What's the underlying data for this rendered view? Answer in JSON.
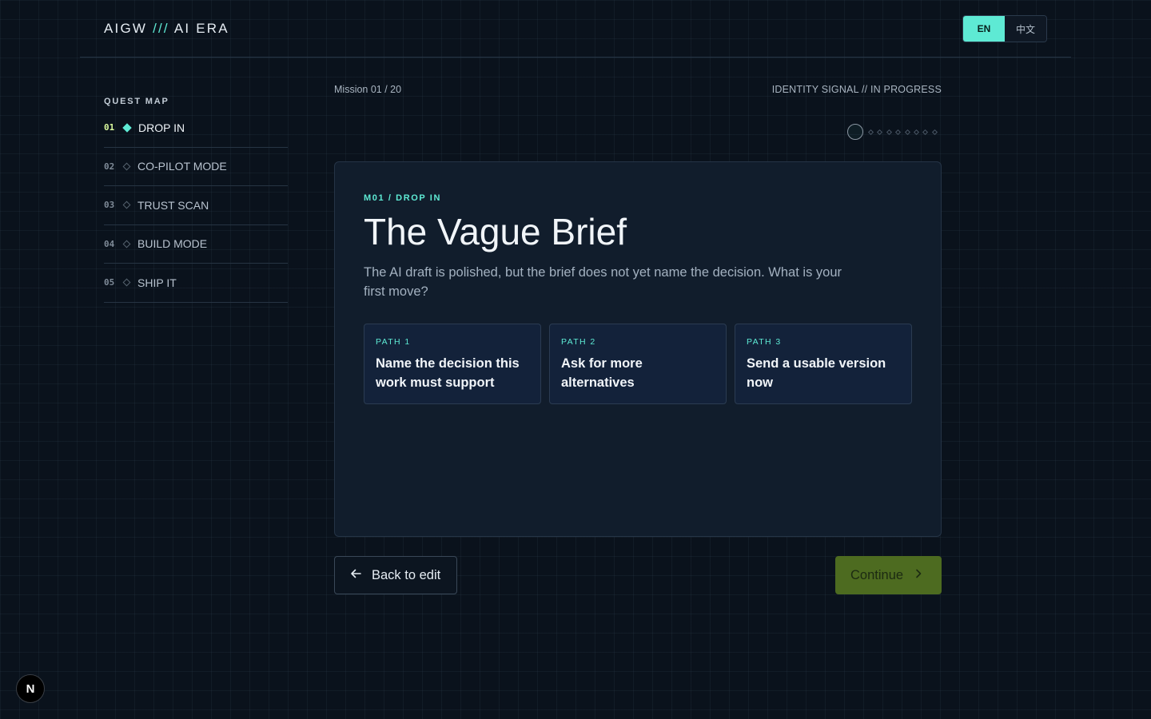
{
  "header": {
    "brand_left": "AIGW",
    "brand_slashes": "///",
    "brand_right": "AI ERA",
    "lang_en": "EN",
    "lang_zh": "中文"
  },
  "sidebar": {
    "title": "QUEST MAP",
    "items": [
      {
        "num": "01",
        "label": "DROP IN",
        "active": true
      },
      {
        "num": "02",
        "label": "CO-PILOT MODE",
        "active": false
      },
      {
        "num": "03",
        "label": "TRUST SCAN",
        "active": false
      },
      {
        "num": "04",
        "label": "BUILD MODE",
        "active": false
      },
      {
        "num": "05",
        "label": "SHIP IT",
        "active": false
      }
    ]
  },
  "mission": {
    "count": "Mission 01 / 20",
    "status": "IDENTITY SIGNAL // IN PROGRESS",
    "tag": "M01 / DROP IN",
    "title": "The Vague Brief",
    "description": "The AI draft is polished, but the brief does not yet name the decision. What is your first move?",
    "paths": [
      {
        "tag": "PATH 1",
        "text": "Name the decision this work must support"
      },
      {
        "tag": "PATH 2",
        "text": "Ask for more alternatives"
      },
      {
        "tag": "PATH 3",
        "text": "Send a usable version now"
      }
    ]
  },
  "actions": {
    "back_label": "Back to edit",
    "continue_label": "Continue"
  },
  "badge": {
    "letter": "N"
  },
  "icons": {
    "back": "arrow-left-icon",
    "continue": "chevron-right-icon"
  },
  "colors": {
    "accent": "#5eead4",
    "active_num": "#d9f99d",
    "continue_bg": "#4d6b20",
    "background": "#0a121c",
    "card": "#111d2c"
  }
}
